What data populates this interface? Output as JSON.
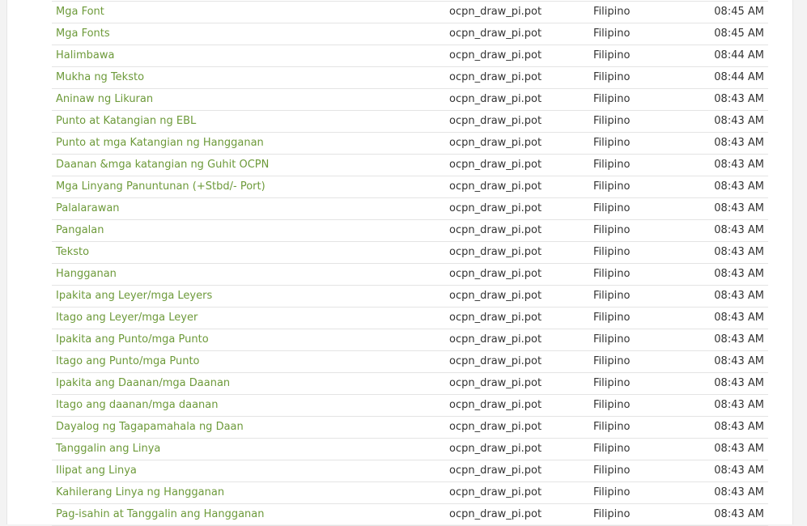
{
  "colors": {
    "link": "#6d9a3a",
    "text": "#333333",
    "divider": "#e4e4e4",
    "background": "#f3f3f3",
    "panel": "#ffffff"
  },
  "rows": [
    {
      "title": "Mga Font",
      "file": "ocpn_draw_pi.pot",
      "language": "Filipino",
      "time": "08:45 AM"
    },
    {
      "title": "Mga Fonts",
      "file": "ocpn_draw_pi.pot",
      "language": "Filipino",
      "time": "08:45 AM"
    },
    {
      "title": "Halimbawa",
      "file": "ocpn_draw_pi.pot",
      "language": "Filipino",
      "time": "08:44 AM"
    },
    {
      "title": "Mukha ng Teksto",
      "file": "ocpn_draw_pi.pot",
      "language": "Filipino",
      "time": "08:44 AM"
    },
    {
      "title": "Aninaw ng Likuran",
      "file": "ocpn_draw_pi.pot",
      "language": "Filipino",
      "time": "08:43 AM"
    },
    {
      "title": "Punto at Katangian ng EBL",
      "file": "ocpn_draw_pi.pot",
      "language": "Filipino",
      "time": "08:43 AM"
    },
    {
      "title": "Punto at mga Katangian ng Hangganan",
      "file": "ocpn_draw_pi.pot",
      "language": "Filipino",
      "time": "08:43 AM"
    },
    {
      "title": "Daanan &mga katangian ng Guhit OCPN",
      "file": "ocpn_draw_pi.pot",
      "language": "Filipino",
      "time": "08:43 AM"
    },
    {
      "title": "Mga Linyang Panuntunan (+Stbd/- Port)",
      "file": "ocpn_draw_pi.pot",
      "language": "Filipino",
      "time": "08:43 AM"
    },
    {
      "title": "Palalarawan",
      "file": "ocpn_draw_pi.pot",
      "language": "Filipino",
      "time": "08:43 AM"
    },
    {
      "title": "Pangalan",
      "file": "ocpn_draw_pi.pot",
      "language": "Filipino",
      "time": "08:43 AM"
    },
    {
      "title": "Teksto",
      "file": "ocpn_draw_pi.pot",
      "language": "Filipino",
      "time": "08:43 AM"
    },
    {
      "title": "Hangganan",
      "file": "ocpn_draw_pi.pot",
      "language": "Filipino",
      "time": "08:43 AM"
    },
    {
      "title": "Ipakita ang Leyer/mga Leyers",
      "file": "ocpn_draw_pi.pot",
      "language": "Filipino",
      "time": "08:43 AM"
    },
    {
      "title": "Itago ang Leyer/mga Leyer",
      "file": "ocpn_draw_pi.pot",
      "language": "Filipino",
      "time": "08:43 AM"
    },
    {
      "title": "Ipakita ang Punto/mga Punto",
      "file": "ocpn_draw_pi.pot",
      "language": "Filipino",
      "time": "08:43 AM"
    },
    {
      "title": "Itago ang Punto/mga Punto",
      "file": "ocpn_draw_pi.pot",
      "language": "Filipino",
      "time": "08:43 AM"
    },
    {
      "title": "Ipakita ang Daanan/mga Daanan",
      "file": "ocpn_draw_pi.pot",
      "language": "Filipino",
      "time": "08:43 AM"
    },
    {
      "title": "Itago ang daanan/mga daanan",
      "file": "ocpn_draw_pi.pot",
      "language": "Filipino",
      "time": "08:43 AM"
    },
    {
      "title": "Dayalog ng Tagapamahala ng Daan",
      "file": "ocpn_draw_pi.pot",
      "language": "Filipino",
      "time": "08:43 AM"
    },
    {
      "title": "Tanggalin ang Linya",
      "file": "ocpn_draw_pi.pot",
      "language": "Filipino",
      "time": "08:43 AM"
    },
    {
      "title": "Ilipat ang Linya",
      "file": "ocpn_draw_pi.pot",
      "language": "Filipino",
      "time": "08:43 AM"
    },
    {
      "title": "Kahilerang Linya ng Hangganan",
      "file": "ocpn_draw_pi.pot",
      "language": "Filipino",
      "time": "08:43 AM"
    },
    {
      "title": "Pag-isahin at Tanggalin ang Hangganan",
      "file": "ocpn_draw_pi.pot",
      "language": "Filipino",
      "time": "08:43 AM"
    }
  ]
}
